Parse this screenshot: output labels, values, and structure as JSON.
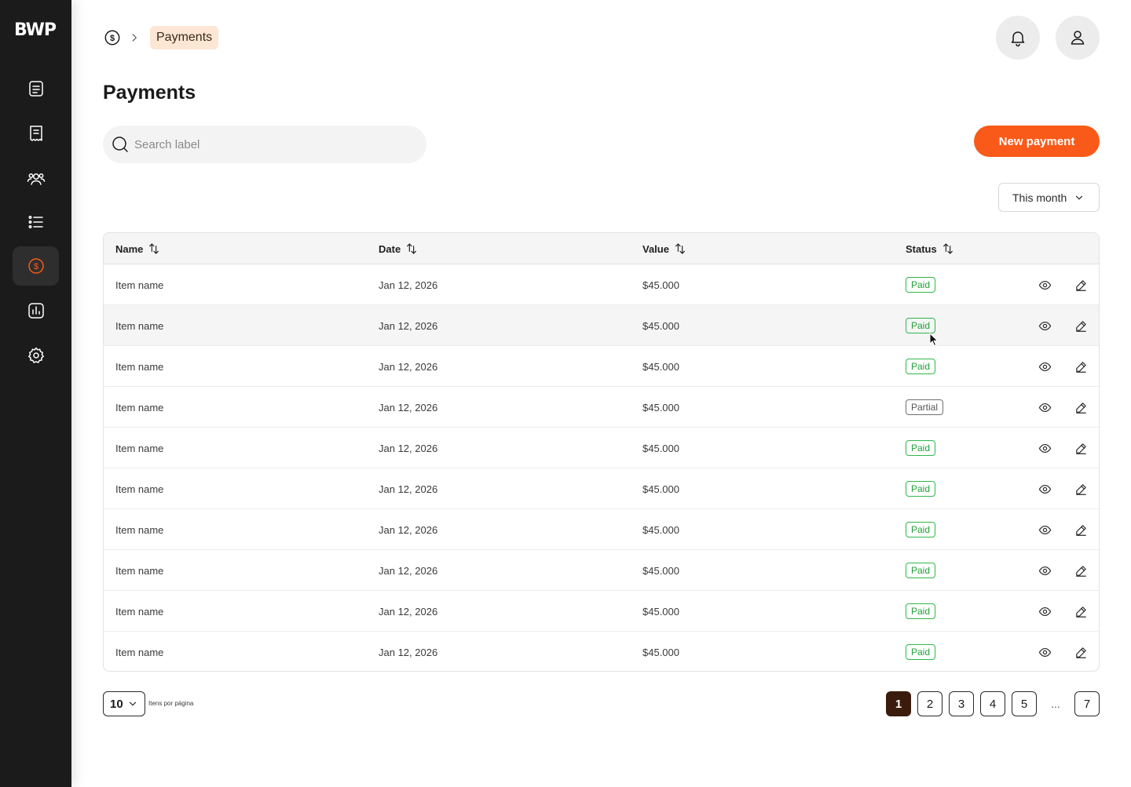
{
  "logo": "BWP",
  "sidebar": {
    "items": [
      {
        "icon": "document-icon",
        "active": false
      },
      {
        "icon": "receipt-icon",
        "active": false
      },
      {
        "icon": "users-icon",
        "active": false
      },
      {
        "icon": "list-icon",
        "active": false
      },
      {
        "icon": "payments-icon",
        "active": true
      },
      {
        "icon": "reports-icon",
        "active": false
      },
      {
        "icon": "settings-icon",
        "active": false
      }
    ]
  },
  "breadcrumb": {
    "icon": "dollar-circle-icon",
    "current": "Payments"
  },
  "header": {
    "notifications_icon": "bell-icon",
    "profile_icon": "user-icon"
  },
  "page": {
    "title": "Payments"
  },
  "search": {
    "placeholder": "Search label"
  },
  "actions": {
    "new_payment": "New payment"
  },
  "filter": {
    "period": "This month"
  },
  "table": {
    "columns": [
      "Name",
      "Date",
      "Value",
      "Status"
    ],
    "rows": [
      {
        "name": "Item name",
        "date": "Jan 12, 2026",
        "value": "$45.000",
        "status": "Paid"
      },
      {
        "name": "Item name",
        "date": "Jan 12, 2026",
        "value": "$45.000",
        "status": "Paid"
      },
      {
        "name": "Item name",
        "date": "Jan 12, 2026",
        "value": "$45.000",
        "status": "Paid"
      },
      {
        "name": "Item name",
        "date": "Jan 12, 2026",
        "value": "$45.000",
        "status": "Partial"
      },
      {
        "name": "Item name",
        "date": "Jan 12, 2026",
        "value": "$45.000",
        "status": "Paid"
      },
      {
        "name": "Item name",
        "date": "Jan 12, 2026",
        "value": "$45.000",
        "status": "Paid"
      },
      {
        "name": "Item name",
        "date": "Jan 12, 2026",
        "value": "$45.000",
        "status": "Paid"
      },
      {
        "name": "Item name",
        "date": "Jan 12, 2026",
        "value": "$45.000",
        "status": "Paid"
      },
      {
        "name": "Item name",
        "date": "Jan 12, 2026",
        "value": "$45.000",
        "status": "Paid"
      },
      {
        "name": "Item name",
        "date": "Jan 12, 2026",
        "value": "$45.000",
        "status": "Paid"
      }
    ]
  },
  "pagination": {
    "per_page": "10",
    "per_page_label": "Itens por página",
    "pages": [
      "1",
      "2",
      "3",
      "4",
      "5"
    ],
    "ellipsis": "...",
    "last": "7",
    "current": "1"
  },
  "colors": {
    "accent": "#fa5a19",
    "sidebar": "#1b1b1b",
    "paid": "#23a03a",
    "active_page": "#3b1c0c",
    "breadcrumb_bg": "#fde6d4"
  }
}
